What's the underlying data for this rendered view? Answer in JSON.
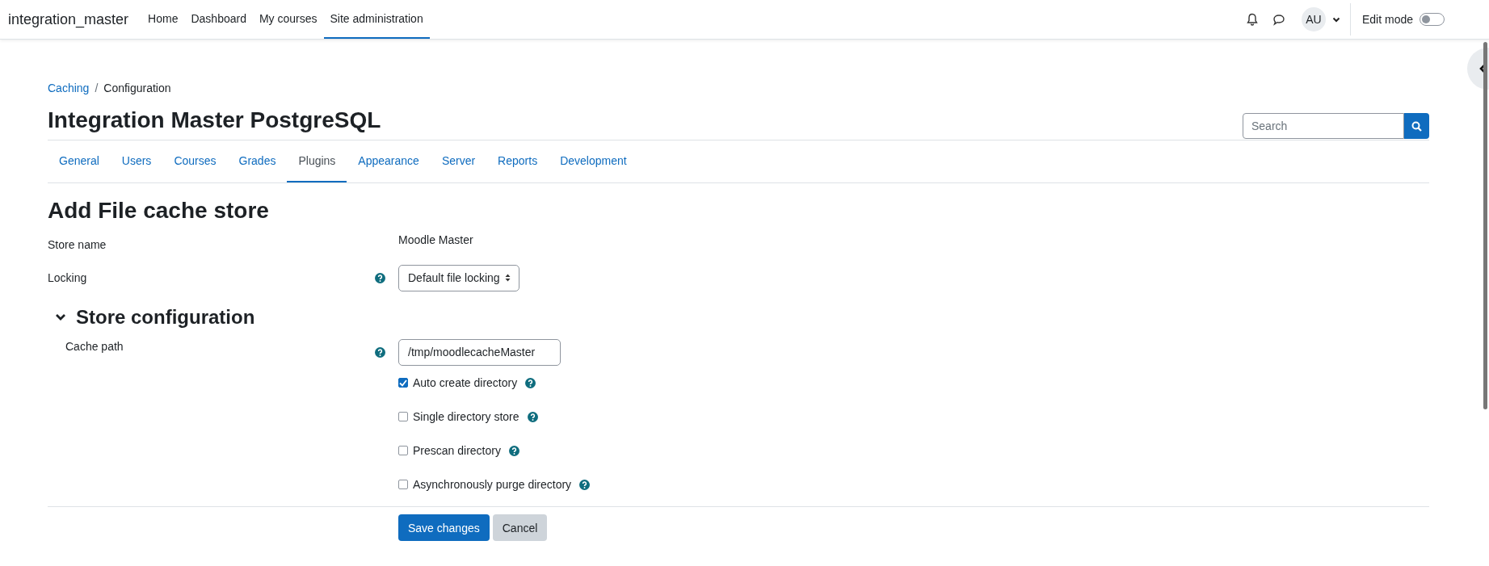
{
  "navbar": {
    "brand": "integration_master",
    "items": [
      {
        "label": "Home",
        "selected": false
      },
      {
        "label": "Dashboard",
        "selected": false
      },
      {
        "label": "My courses",
        "selected": false
      },
      {
        "label": "Site administration",
        "selected": true
      }
    ],
    "user_initials": "AU",
    "edit_mode": {
      "label": "Edit mode",
      "on": false
    }
  },
  "breadcrumb_separator": "/",
  "breadcrumb": [
    {
      "label": "Caching",
      "kind": "link"
    },
    {
      "label": "Configuration",
      "kind": "current"
    }
  ],
  "page_title": "Integration Master PostgreSQL",
  "search": {
    "placeholder": "Search"
  },
  "tabs": [
    {
      "label": "General",
      "selected": false
    },
    {
      "label": "Users",
      "selected": false
    },
    {
      "label": "Courses",
      "selected": false
    },
    {
      "label": "Grades",
      "selected": false
    },
    {
      "label": "Plugins",
      "selected": true
    },
    {
      "label": "Appearance",
      "selected": false
    },
    {
      "label": "Server",
      "selected": false
    },
    {
      "label": "Reports",
      "selected": false
    },
    {
      "label": "Development",
      "selected": false
    }
  ],
  "form": {
    "heading": "Add File cache store",
    "fields": [
      {
        "kind": "static",
        "label": "Store name",
        "value": "Moodle Master"
      },
      {
        "kind": "select",
        "label": "Locking",
        "value": "Default file locking",
        "help": true
      }
    ],
    "section": {
      "title": "Store configuration",
      "expanded": true,
      "fields": [
        {
          "kind": "text",
          "label": "Cache path",
          "value": "/tmp/moodlecacheMaster",
          "help": true
        }
      ],
      "checkboxes": [
        {
          "label": "Auto create directory",
          "checked": true
        },
        {
          "label": "Single directory store",
          "checked": false
        },
        {
          "label": "Prescan directory",
          "checked": false
        },
        {
          "label": "Asynchronously purge directory",
          "checked": false
        }
      ]
    },
    "buttons": [
      {
        "label": "Save changes",
        "kind": "primary"
      },
      {
        "label": "Cancel",
        "kind": "secondary"
      }
    ]
  }
}
